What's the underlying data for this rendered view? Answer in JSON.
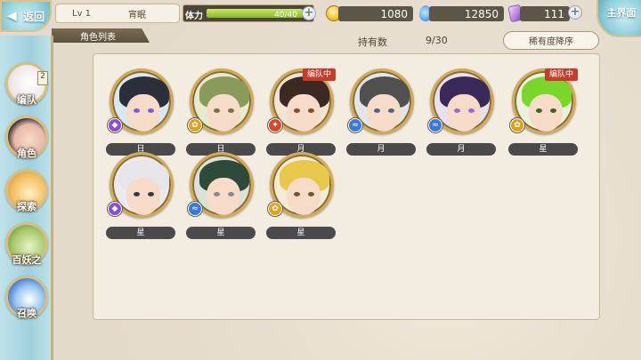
{
  "header": {
    "back_label": "返回",
    "level": "Lv 1",
    "player_name": "宵眠",
    "stamina_label": "体力",
    "stamina_value": "40/40",
    "stamina_fraction": 1.0,
    "gold": "1080",
    "jade": "12850",
    "tickets": "111",
    "main_label": "主界面"
  },
  "list": {
    "tab_label": "角色列表",
    "count_label": "持有数",
    "count_value": "9/30",
    "sort_label": "稀有度降序"
  },
  "nav": [
    {
      "label": "编队",
      "badge": "2"
    },
    {
      "label": "角色"
    },
    {
      "label": "探索"
    },
    {
      "label": "百妖之"
    },
    {
      "label": "召唤"
    }
  ],
  "characters": [
    {
      "tag": "日",
      "badge": "",
      "attr_color": "#8a4fd0",
      "hair": "#2a2f3a",
      "eye": "#7c5cd6"
    },
    {
      "tag": "日",
      "badge": "",
      "attr_color": "#e0a020",
      "hair": "#8a9a5a",
      "eye": "#6a7c3a"
    },
    {
      "tag": "月",
      "badge": "编队中",
      "attr_color": "#d24a2a",
      "hair": "#3a2a22",
      "eye": "#8a4a2a"
    },
    {
      "tag": "月",
      "badge": "",
      "attr_color": "#3a7ad6",
      "hair": "#505050",
      "eye": "#4a6a8a"
    },
    {
      "tag": "月",
      "badge": "",
      "attr_color": "#3a7ad6",
      "hair": "#3a2a5a",
      "eye": "#9a6ad6"
    },
    {
      "tag": "星",
      "badge": "编队中",
      "attr_color": "#e0a020",
      "hair": "#7ad62a",
      "eye": "#3a6a1a"
    },
    {
      "tag": "星",
      "badge": "",
      "attr_color": "#8a4fd0",
      "hair": "#e6e6ea",
      "eye": "#3a3a3a"
    },
    {
      "tag": "星",
      "badge": "",
      "attr_color": "#3a7ad6",
      "hair": "#2e4a3a",
      "eye": "#8a8a8a"
    },
    {
      "tag": "星",
      "badge": "",
      "attr_color": "#e0a020",
      "hair": "#e8c84a",
      "eye": "#6a5a2a"
    }
  ]
}
